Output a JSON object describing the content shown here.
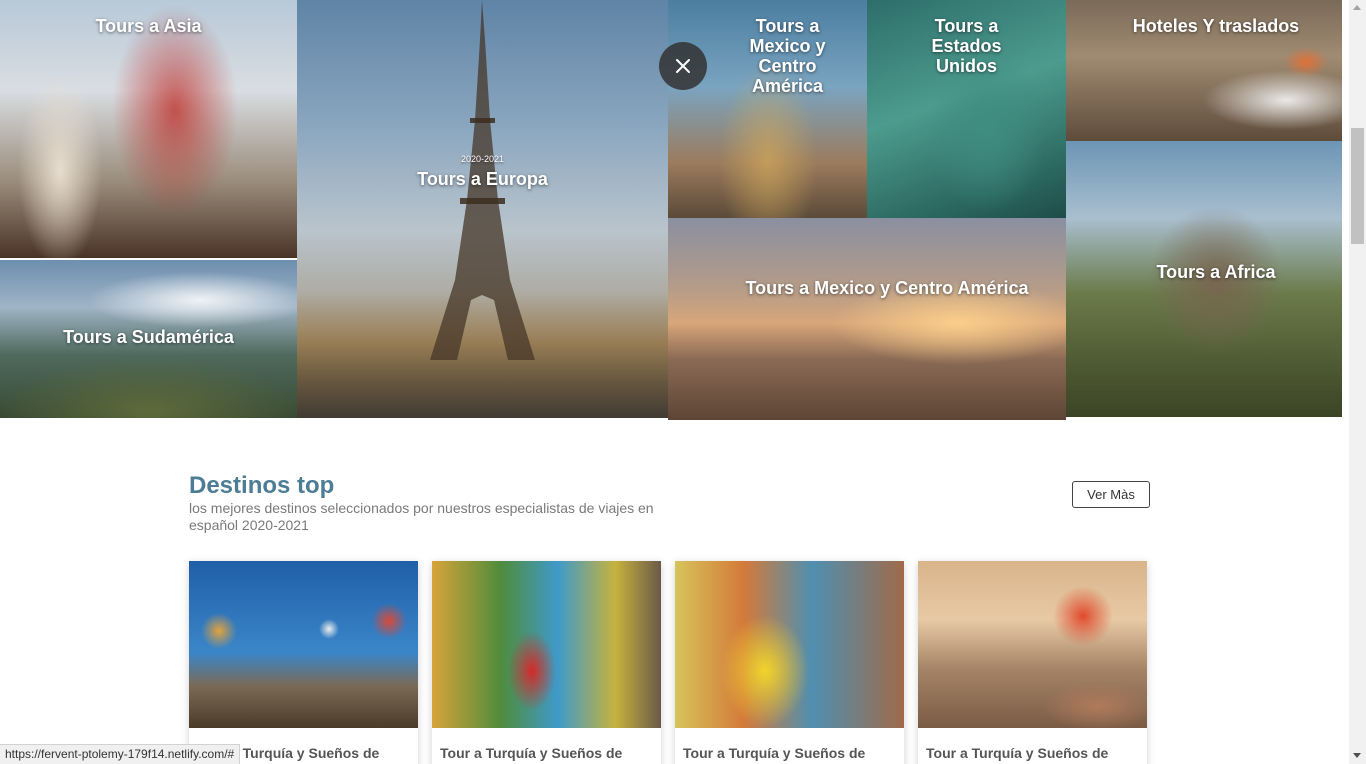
{
  "hero": {
    "tiles": {
      "asia": {
        "label": "Tours a Asia"
      },
      "sudamerica": {
        "label": "Tours a Sudamérica"
      },
      "europa": {
        "eyebrow": "2020-2021",
        "label": "Tours a Europa"
      },
      "mexico_tall": {
        "label": "Tours a Mexico y Centro América"
      },
      "usa": {
        "label": "Tours a Estados Unidos"
      },
      "mexico_wide": {
        "label": "Tours a Mexico y Centro América"
      },
      "hoteles": {
        "label": "Hoteles Y traslados"
      },
      "africa": {
        "label": "Tours a Africa"
      }
    },
    "close_icon": "close-icon"
  },
  "destinos": {
    "title": "Destinos top",
    "subtitle": "los mejores destinos seleccionados por nuestros especialistas de viajes en español 2020-2021",
    "more_button": "Ver Màs",
    "cards": [
      {
        "title": "Tour a Turquía y Sueños de"
      },
      {
        "title": "Tour a Turquía y Sueños de"
      },
      {
        "title": "Tour a Turquía y Sueños de"
      },
      {
        "title": "Tour a Turquía y Sueños de"
      }
    ]
  },
  "status_bar": {
    "url": "https://fervent-ptolemy-179f14.netlify.com/#"
  },
  "colors": {
    "accent": "#4c7d95",
    "subtitle": "#7a7a7a"
  }
}
